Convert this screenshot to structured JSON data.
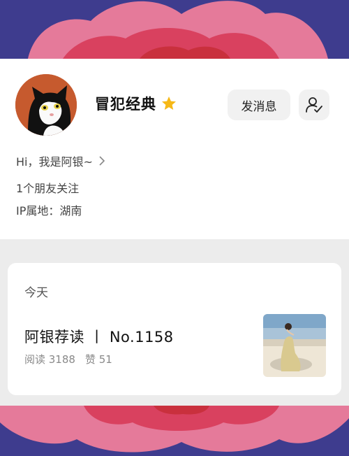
{
  "profile": {
    "name": "冒犯经典",
    "bio": "Hi，我是阿银~",
    "friends": "1个朋友关注",
    "ip": "IP属地：湖南"
  },
  "actions": {
    "message_label": "发消息"
  },
  "feed": {
    "day_label": "今天",
    "post": {
      "title": "阿银荐读 丨 No.1158",
      "reads": "阅读 3188",
      "likes": "赞 51"
    }
  },
  "colors": {
    "banner_navy": "#3e3c8e",
    "banner_pink": "#e57a9a",
    "banner_rose": "#d9415f",
    "banner_red": "#c9303d",
    "star": "#f6b817"
  },
  "icons": {
    "star": "star-icon",
    "follow": "user-check-icon",
    "chevron": "chevron-right-icon"
  }
}
